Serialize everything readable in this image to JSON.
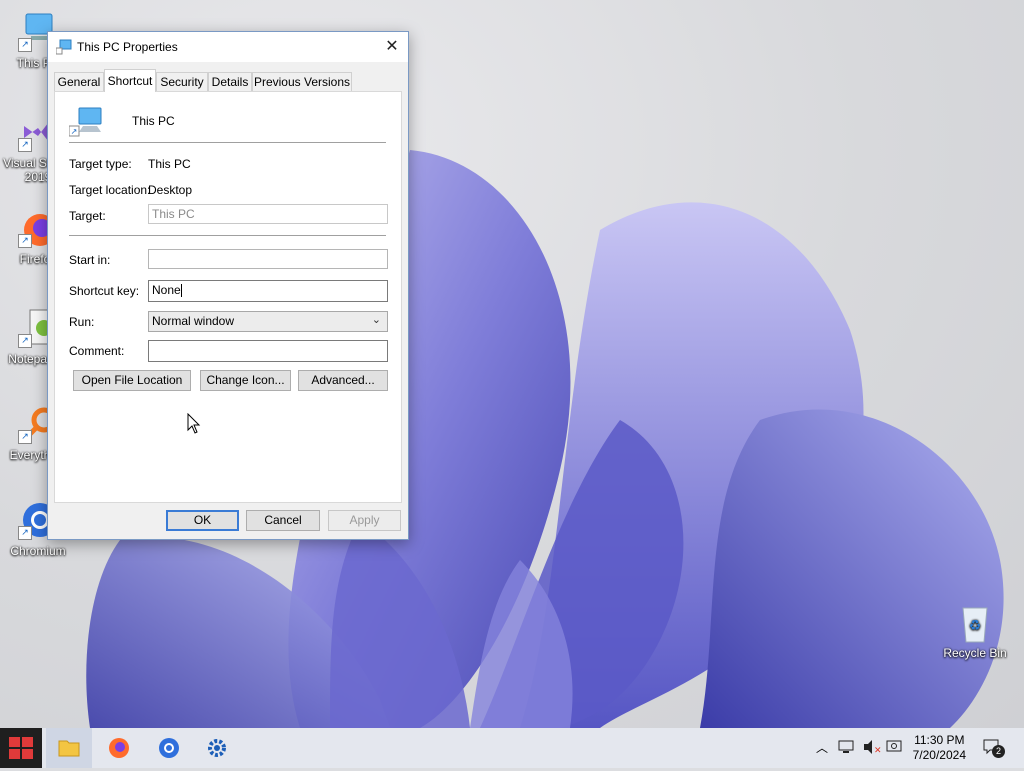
{
  "desktop": {
    "icons": [
      {
        "label": "This PC",
        "icon": "monitor-icon"
      },
      {
        "label": "Visual Studio 2019",
        "icon": "visual-studio-icon"
      },
      {
        "label": "Firefox",
        "icon": "firefox-icon"
      },
      {
        "label": "Notepad++",
        "icon": "notepad-plus-icon"
      },
      {
        "label": "Everything",
        "icon": "everything-search-icon"
      },
      {
        "label": "Chromium",
        "icon": "chromium-icon"
      }
    ],
    "recycle_bin": {
      "label": "Recycle Bin",
      "icon": "recycle-bin-icon"
    }
  },
  "dialog": {
    "title": "This PC Properties",
    "tabs": [
      {
        "label": "General",
        "active": false
      },
      {
        "label": "Shortcut",
        "active": true
      },
      {
        "label": "Security",
        "active": false
      },
      {
        "label": "Details",
        "active": false
      },
      {
        "label": "Previous Versions",
        "active": false
      }
    ],
    "shortcut": {
      "name": "This PC",
      "target_type_label": "Target type:",
      "target_type_value": "This PC",
      "target_location_label": "Target location:",
      "target_location_value": "Desktop",
      "target_label": "Target:",
      "target_value": "This PC",
      "start_in_label": "Start in:",
      "start_in_value": "",
      "shortcut_key_label": "Shortcut key:",
      "shortcut_key_value": "None",
      "run_label": "Run:",
      "run_value": "Normal window",
      "comment_label": "Comment:",
      "comment_value": "",
      "open_location_button": "Open File Location",
      "change_icon_button": "Change Icon...",
      "advanced_button": "Advanced..."
    },
    "buttons": {
      "ok": "OK",
      "cancel": "Cancel",
      "apply": "Apply"
    }
  },
  "taskbar": {
    "items": [
      "start-icon",
      "file-explorer-icon",
      "firefox-icon",
      "chromium-icon",
      "settings-gear-icon"
    ],
    "clock_time": "11:30 PM",
    "clock_date": "7/20/2024",
    "notifications_count": "2"
  },
  "colors": {
    "accent": "#3a7bd5",
    "wallpaper_petal": "#6f6fd0",
    "taskbar": "#e4e7ee"
  }
}
